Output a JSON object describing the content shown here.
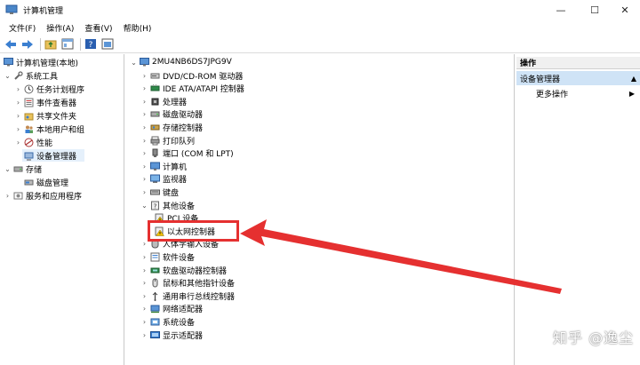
{
  "window": {
    "title": "计算机管理",
    "minimize_glyph": "—",
    "maximize_glyph": "☐",
    "close_glyph": "✕"
  },
  "menubar": [
    {
      "label": "文件(F)"
    },
    {
      "label": "操作(A)"
    },
    {
      "label": "查看(V)"
    },
    {
      "label": "帮助(H)"
    }
  ],
  "left_tree": {
    "root": "计算机管理(本地)",
    "system_tools": "系统工具",
    "task_scheduler": "任务计划程序",
    "event_viewer": "事件查看器",
    "shared_folders": "共享文件夹",
    "local_users": "本地用户和组",
    "performance": "性能",
    "device_manager": "设备管理器",
    "storage": "存储",
    "disk_management": "磁盘管理",
    "services_apps": "服务和应用程序"
  },
  "device_tree": {
    "computer_name": "2MU4NB6DS7JPG9V",
    "items": [
      {
        "label": "DVD/CD-ROM 驱动器",
        "icon": "dvd-drive-icon",
        "expanded": false
      },
      {
        "label": "IDE ATA/ATAPI 控制器",
        "icon": "ide-controller-icon",
        "expanded": false
      },
      {
        "label": "处理器",
        "icon": "processor-icon",
        "expanded": false
      },
      {
        "label": "磁盘驱动器",
        "icon": "disk-drive-icon",
        "expanded": false
      },
      {
        "label": "存储控制器",
        "icon": "storage-controller-icon",
        "expanded": false
      },
      {
        "label": "打印队列",
        "icon": "printer-icon",
        "expanded": false
      },
      {
        "label": "端口 (COM 和 LPT)",
        "icon": "port-icon",
        "expanded": false
      },
      {
        "label": "计算机",
        "icon": "computer-icon",
        "expanded": false
      },
      {
        "label": "监视器",
        "icon": "monitor-icon",
        "expanded": false
      },
      {
        "label": "键盘",
        "icon": "keyboard-icon",
        "expanded": false
      },
      {
        "label": "其他设备",
        "icon": "unknown-device-icon",
        "expanded": true
      },
      {
        "label": "PCI 设备",
        "icon": "warning-device-icon",
        "child": true
      },
      {
        "label": "以太网控制器",
        "icon": "warning-device-icon",
        "child": true
      },
      {
        "label": "人体学输入设备",
        "icon": "hid-icon",
        "expanded": false
      },
      {
        "label": "软件设备",
        "icon": "software-device-icon",
        "expanded": false
      },
      {
        "label": "软盘驱动器控制器",
        "icon": "floppy-controller-icon",
        "expanded": false
      },
      {
        "label": "鼠标和其他指针设备",
        "icon": "mouse-icon",
        "expanded": false
      },
      {
        "label": "通用串行总线控制器",
        "icon": "usb-icon",
        "expanded": false
      },
      {
        "label": "网络适配器",
        "icon": "network-adapter-icon",
        "expanded": false
      },
      {
        "label": "系统设备",
        "icon": "system-device-icon",
        "expanded": false
      },
      {
        "label": "显示适配器",
        "icon": "display-adapter-icon",
        "expanded": false
      }
    ]
  },
  "actions": {
    "header": "操作",
    "section": "设备管理器",
    "more": "更多操作"
  },
  "watermark": "知乎 @逸尘",
  "colors": {
    "highlight": "#e53030",
    "selection": "#cfe3f6",
    "accent": "#2a6fc9"
  }
}
